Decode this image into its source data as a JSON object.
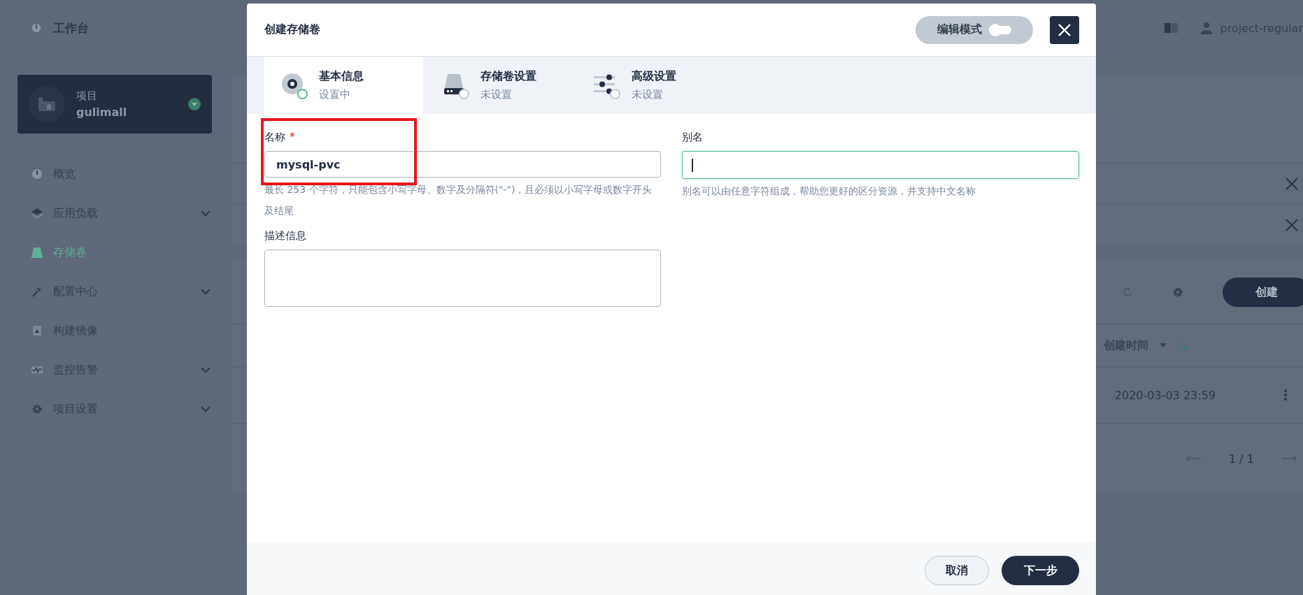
{
  "sidebar": {
    "workbench": "工作台",
    "project": {
      "label": "项目",
      "name": "gulimall"
    },
    "items": [
      {
        "label": "概览",
        "expandable": false,
        "selected": false
      },
      {
        "label": "应用负载",
        "expandable": true,
        "selected": false
      },
      {
        "label": "存储卷",
        "expandable": false,
        "selected": true
      },
      {
        "label": "配置中心",
        "expandable": true,
        "selected": false
      },
      {
        "label": "构建镜像",
        "expandable": false,
        "selected": false
      },
      {
        "label": "监控告警",
        "expandable": true,
        "selected": false
      },
      {
        "label": "项目设置",
        "expandable": true,
        "selected": false
      }
    ]
  },
  "topbar": {
    "user": "project-regular"
  },
  "background_list": {
    "create_button": "创建",
    "column_header": "创建时间",
    "rows": [
      {
        "created": "2020-03-03 23:59"
      }
    ],
    "pagination": "1 / 1"
  },
  "modal": {
    "title": "创建存储卷",
    "edit_mode": {
      "label": "编辑模式",
      "on": false
    },
    "steps": [
      {
        "title": "基本信息",
        "status": "设置中",
        "selected": true
      },
      {
        "title": "存储卷设置",
        "status": "未设置",
        "selected": false
      },
      {
        "title": "高级设置",
        "status": "未设置",
        "selected": false
      }
    ],
    "name_field": {
      "label": "名称",
      "required_mark": "*",
      "value": "mysql-pvc",
      "hint": "最长 253 个字符，只能包含小写字母、数字及分隔符(\"-\")，且必须以小写字母或数字开头及结尾"
    },
    "alias_field": {
      "label": "别名",
      "focused": true,
      "hint": "别名可以由任意字符组成，帮助您更好的区分资源，并支持中文名称"
    },
    "description_field": {
      "label": "描述信息"
    },
    "buttons": {
      "cancel": "取消",
      "next": "下一步"
    }
  }
}
